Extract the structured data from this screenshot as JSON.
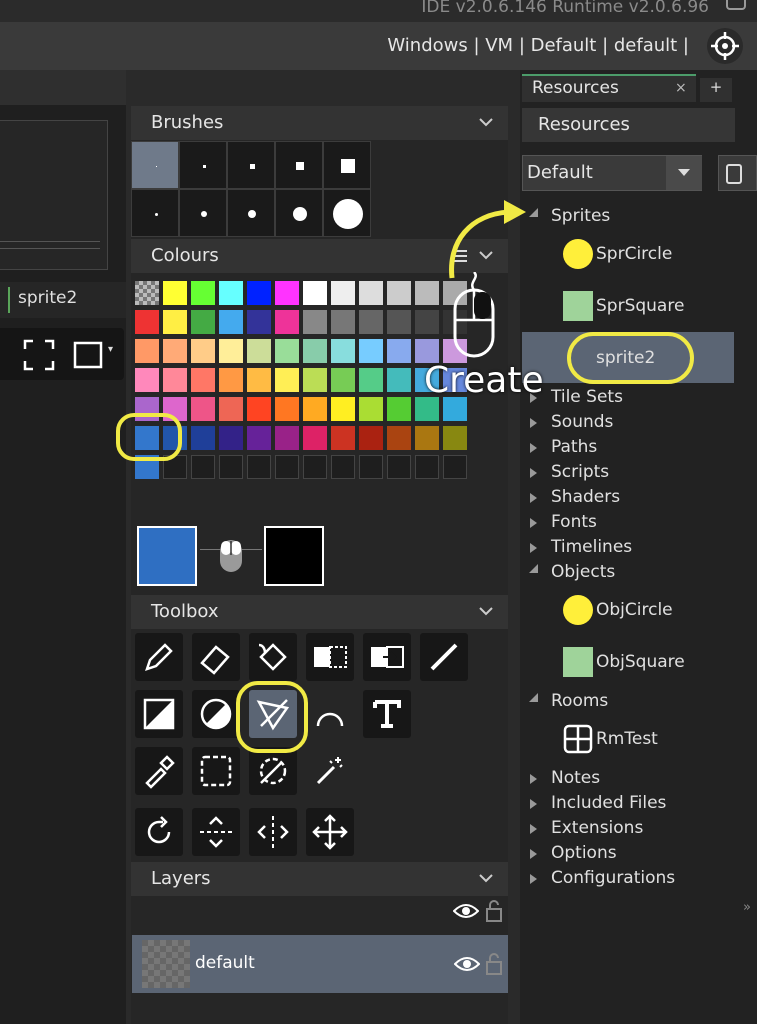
{
  "header": {
    "ide_version": "IDE v2.0.6.146 Runtime v2.0.6.96",
    "target_config": "Windows | VM | Default | default |"
  },
  "left_panel": {
    "sprite_tab_label": "sprite2"
  },
  "brushes": {
    "title": "Brushes"
  },
  "colours": {
    "title": "Colours",
    "palette_rows": [
      [
        "checker",
        "#ffff33",
        "#66ff33",
        "#66ffff",
        "#0022ff",
        "#ff33ff",
        "#ffffff",
        "#eeeeee",
        "#dddddd",
        "#cccccc",
        "#bbbbbb",
        "#aaaaaa"
      ],
      [
        "#ee3333",
        "#ffee44",
        "#44aa44",
        "#44aaee",
        "#333399",
        "#ee3399",
        "#888888",
        "#777777",
        "#666666",
        "#555555",
        "#444444",
        "#333333"
      ],
      [
        "#ff9966",
        "#ffaa77",
        "#ffcc88",
        "#ffee99",
        "#ccdd99",
        "#99dd99",
        "#88ccaa",
        "#88dddd",
        "#77ccff",
        "#88aaee",
        "#9999dd",
        "#cc99dd"
      ],
      [
        "#ff88bb",
        "#ff8899",
        "#ff7766",
        "#ff9944",
        "#ffbb44",
        "#ffee55",
        "#bbdd55",
        "#77cc55",
        "#55cc88",
        "#44bbbb",
        "#44aadd",
        "#6688dd"
      ],
      [
        "#aa66cc",
        "#dd66cc",
        "#ee5588",
        "#ee6655",
        "#ff4422",
        "#ff7722",
        "#ffaa22",
        "#ffee22",
        "#aadd33",
        "#55cc33",
        "#33bb88",
        "#33aadd"
      ],
      [
        "#3377cc",
        "#2255aa",
        "#1f3f99",
        "#332288",
        "#662299",
        "#992288",
        "#dd2266",
        "#cc3322",
        "#aa2211",
        "#aa4411",
        "#aa7711",
        "#888811"
      ],
      [
        "#3377cc",
        "",
        "",
        "",
        "",
        "",
        "",
        "",
        "",
        "",
        "",
        ""
      ]
    ],
    "primary_colour": "#2f6fc2",
    "secondary_colour": "#000000"
  },
  "toolbox": {
    "title": "Toolbox",
    "tools": [
      "pencil-tool",
      "eraser-tool",
      "fill-tool",
      "copy-tool",
      "paste-tool",
      "line-tool",
      "rectangle-tool",
      "ellipse-tool",
      "polygon-tool",
      "arc-tool",
      "text-tool",
      "eyedropper-tool",
      "select-rect-tool",
      "select-lasso-tool",
      "magic-wand-tool",
      "rotate-tool",
      "flip-vertical-tool",
      "flip-horizontal-tool",
      "move-tool"
    ]
  },
  "layers": {
    "title": "Layers",
    "items": [
      {
        "name": "default"
      }
    ]
  },
  "resources": {
    "tab_label": "Resources",
    "close_glyph": "×",
    "add_glyph": "+",
    "panel_title": "Resources",
    "dropdown_value": "Default",
    "tree": {
      "sprites": {
        "label": "Sprites",
        "items": [
          "SprCircle",
          "SprSquare",
          "sprite2"
        ]
      },
      "collapsed_1": [
        "Tile Sets",
        "Sounds",
        "Paths",
        "Scripts",
        "Shaders",
        "Fonts",
        "Timelines"
      ],
      "objects": {
        "label": "Objects",
        "items": [
          "ObjCircle",
          "ObjSquare"
        ]
      },
      "rooms": {
        "label": "Rooms",
        "items": [
          "RmTest"
        ]
      },
      "collapsed_2": [
        "Notes",
        "Included Files",
        "Extensions",
        "Options",
        "Configurations"
      ]
    }
  },
  "annotation": {
    "create_label": "Create"
  },
  "colors": {
    "highlight": "#f1ea45",
    "selected_row": "#5b6574",
    "accent_green": "#4c9c6a"
  }
}
